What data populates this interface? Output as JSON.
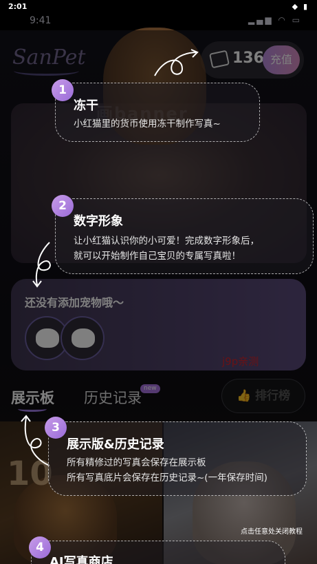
{
  "system_status": {
    "time": "2:01",
    "indicators": "◆ ▮"
  },
  "app_status": {
    "time": "9:41",
    "indicators": "▂▄▆ ◠ ▭"
  },
  "logo": "SanPet",
  "coins": {
    "count": "136",
    "recharge_label": "充值"
  },
  "banner": {
    "watermark_text": "画banner"
  },
  "pet_section": {
    "title": "还没有添加宠物哦～"
  },
  "watermark": "j9p亲测",
  "tabs": {
    "showcase": "展示板",
    "history": "历史记录",
    "new_badge": "new",
    "rank": "排行榜"
  },
  "photo_overlay": {
    "number": "10"
  },
  "tutorial": {
    "steps": [
      {
        "number": "1",
        "title": "冻干",
        "desc": [
          "小红猫里的货币使用冻干制作写真~"
        ]
      },
      {
        "number": "2",
        "title": "数字形象",
        "desc": [
          "让小红猫认识你的小可爱！完成数字形象后，",
          "就可以开始制作自己宝贝的专属写真啦！"
        ]
      },
      {
        "number": "3",
        "title": "展示版&历史记录",
        "desc": [
          "所有精修过的写真会保存在展示板",
          "所有写真底片会保存在历史记录~(一年保存时间)"
        ]
      },
      {
        "number": "4",
        "title": "AI写真商店",
        "desc": []
      }
    ],
    "close_hint": "点击任意处关闭教程"
  }
}
